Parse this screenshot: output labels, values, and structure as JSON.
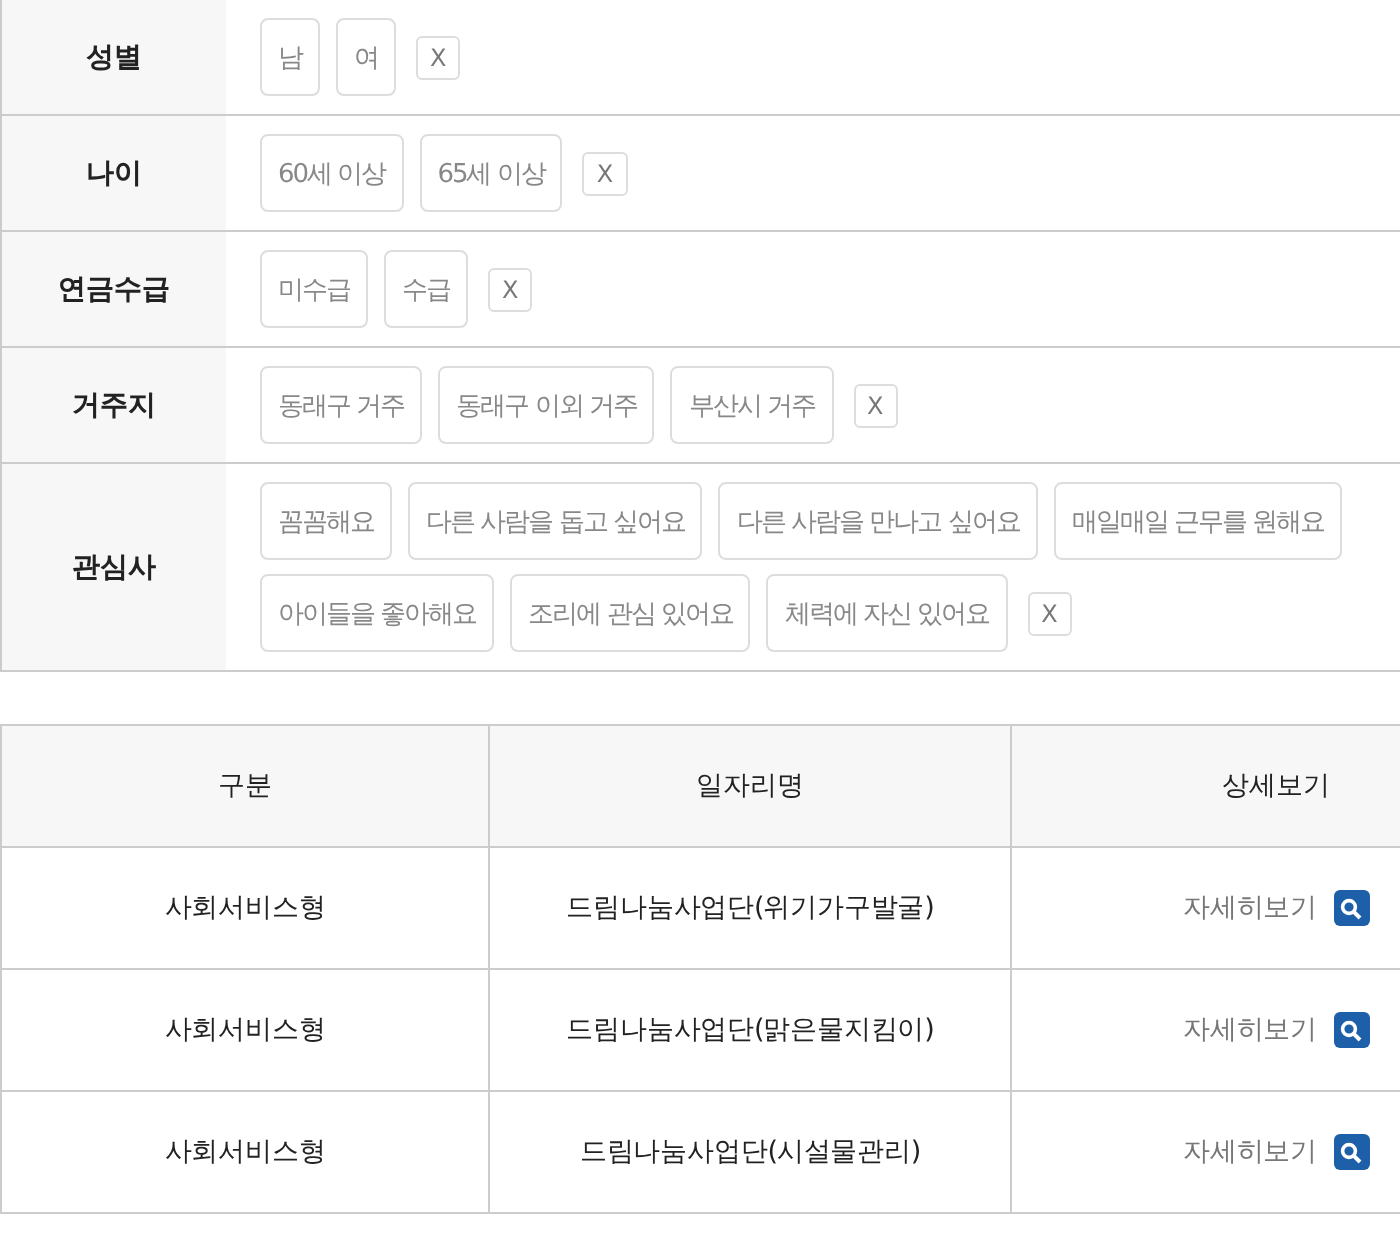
{
  "filters": [
    {
      "label": "성별",
      "options": [
        {
          "text": "남",
          "selected": false
        },
        {
          "text": "여",
          "selected": false
        }
      ],
      "clear": "X"
    },
    {
      "label": "나이",
      "options": [
        {
          "text": "60세 이상",
          "selected": false
        },
        {
          "text": "65세 이상",
          "selected": false
        }
      ],
      "clear": "X"
    },
    {
      "label": "연금수급",
      "options": [
        {
          "text": "미수급",
          "selected": false
        },
        {
          "text": "수급",
          "selected": false
        }
      ],
      "clear": "X"
    },
    {
      "label": "거주지",
      "options": [
        {
          "text": "동래구 거주",
          "selected": false
        },
        {
          "text": "동래구 이외 거주",
          "selected": false
        },
        {
          "text": "부산시 거주",
          "selected": false
        }
      ],
      "clear": "X"
    },
    {
      "label": "관심사",
      "options": [
        {
          "text": "꼼꼼해요",
          "selected": false
        },
        {
          "text": "다른 사람을 돕고 싶어요",
          "selected": false
        },
        {
          "text": "다른 사람을 만나고 싶어요",
          "selected": false
        },
        {
          "text": "매일매일 근무를 원해요",
          "selected": false
        },
        {
          "text": "아이들을 좋아해요",
          "selected": false
        },
        {
          "text": "조리에 관심 있어요",
          "selected": false
        },
        {
          "text": "체력에 자신 있어요",
          "selected": false
        }
      ],
      "clear": "X"
    }
  ],
  "table": {
    "columns": [
      "구분",
      "일자리명",
      "상세보기"
    ],
    "rows": [
      {
        "type": "사회서비스형",
        "name": "드림나눔사업단(위기가구발굴)",
        "detail": "자세히보기"
      },
      {
        "type": "사회서비스형",
        "name": "드림나눔사업단(맑은물지킴이)",
        "detail": "자세히보기"
      },
      {
        "type": "사회서비스형",
        "name": "드림나눔사업단(시설물관리)",
        "detail": "자세히보기"
      }
    ]
  }
}
